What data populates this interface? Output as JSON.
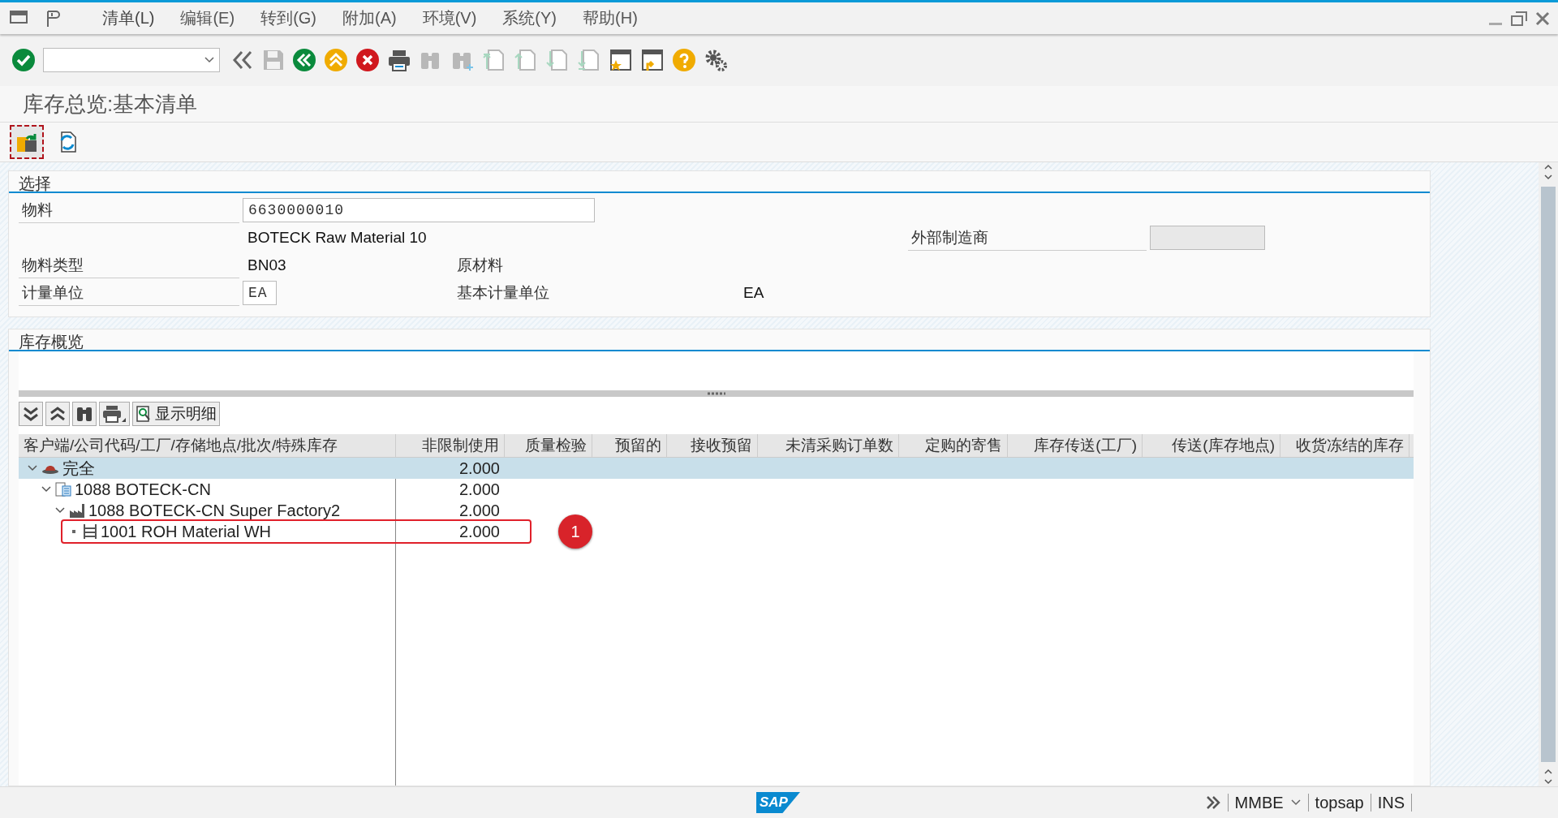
{
  "menu_bar": {
    "items": [
      "清单(L)",
      "编辑(E)",
      "转到(G)",
      "附加(A)",
      "环境(V)",
      "系统(Y)",
      "帮助(H)"
    ]
  },
  "toolbar": {
    "items": [
      {
        "kind": "enter",
        "disabled": false
      },
      {
        "kind": "command-field",
        "disabled": false
      },
      {
        "kind": "nav-back",
        "disabled": false
      },
      {
        "kind": "save",
        "disabled": true
      },
      {
        "kind": "back",
        "disabled": false
      },
      {
        "kind": "exit",
        "disabled": false
      },
      {
        "kind": "cancel",
        "disabled": false
      },
      {
        "kind": "print",
        "disabled": false
      },
      {
        "kind": "find",
        "disabled": true
      },
      {
        "kind": "find-next",
        "disabled": true
      },
      {
        "kind": "first-page",
        "disabled": true
      },
      {
        "kind": "prev-page",
        "disabled": true
      },
      {
        "kind": "next-page",
        "disabled": true
      },
      {
        "kind": "last-page",
        "disabled": true
      },
      {
        "kind": "new-session",
        "disabled": false
      },
      {
        "kind": "shortcut",
        "disabled": false
      },
      {
        "kind": "help",
        "disabled": false
      },
      {
        "kind": "settings",
        "disabled": false
      }
    ]
  },
  "title": "库存总览:基本清单",
  "app_toolbar": {
    "items": [
      {
        "kind": "other-material",
        "focused": true
      },
      {
        "kind": "refresh",
        "focused": false
      }
    ]
  },
  "selection": {
    "title": "选择",
    "material": {
      "label": "物料",
      "value": "6630000010"
    },
    "description": "BOTECK Raw Material 10",
    "external_manufacturer": {
      "label": "外部制造商",
      "disabled": true
    },
    "material_type": {
      "label": "物料类型",
      "value": "BN03",
      "text": "原材料"
    },
    "unit": {
      "label": "计量单位",
      "value": "EA",
      "base_label": "基本计量单位",
      "base_value": "EA"
    }
  },
  "stock_overview": {
    "title": "库存概览",
    "tree_toolbar": {
      "buttons": [
        {
          "kind": "expand-all"
        },
        {
          "kind": "collapse-all"
        },
        {
          "kind": "find"
        },
        {
          "kind": "print-menu"
        },
        {
          "kind": "detail",
          "label": "显示明细"
        }
      ]
    },
    "columns": [
      "客户端/公司代码/工厂/存储地点/批次/特殊库存",
      "非限制使用",
      "质量检验",
      "预留的",
      "接收预留",
      "未清采购订单数",
      "定购的寄售",
      "库存传送(工厂)",
      "传送(库存地点)",
      "收货冻结的库存"
    ],
    "tree": [
      {
        "label": "完全",
        "kind": "client",
        "expanded": true,
        "selected": true,
        "values": [
          "2.000"
        ],
        "children": [
          {
            "label": "1088 BOTECK-CN",
            "kind": "company",
            "expanded": true,
            "selected": false,
            "values": [
              "2.000"
            ],
            "children": [
              {
                "label": "1088 BOTECK-CN Super Factory2",
                "kind": "plant",
                "expanded": true,
                "selected": false,
                "values": [
                  "2.000"
                ],
                "children": [
                  {
                    "label": "1001 ROH Material WH",
                    "kind": "storage",
                    "selected": false,
                    "values": [
                      "2.000"
                    ],
                    "callout": "1"
                  }
                ]
              }
            ]
          }
        ]
      }
    ]
  },
  "status_bar": {
    "logo": "SAP",
    "transaction": "MMBE",
    "user": "topsap",
    "mode": "INS"
  }
}
